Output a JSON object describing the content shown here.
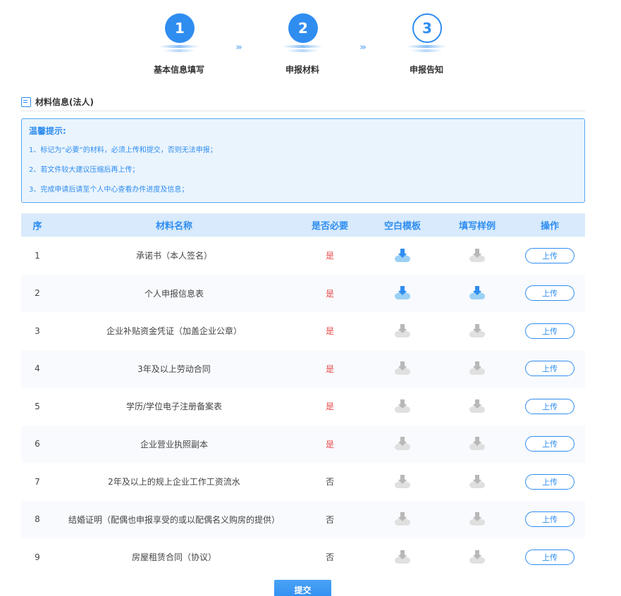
{
  "steps": [
    {
      "number": "1",
      "label": "基本信息填写",
      "state": "active"
    },
    {
      "number": "2",
      "label": "申报材料",
      "state": "active"
    },
    {
      "number": "3",
      "label": "申报告知",
      "state": "inactive"
    }
  ],
  "section": {
    "title": "材料信息(法人)"
  },
  "tips": {
    "title": "温馨提示:",
    "items": [
      "1、标记为“必要”的材料，必须上传和提交，否则无法申报；",
      "2、若文件较大建议压缩后再上传；",
      "3、完成申请后请至个人中心查看办件进度及信息；"
    ]
  },
  "table": {
    "headers": [
      "序",
      "材料名称",
      "是否必要",
      "空白模板",
      "填写样例",
      "操作"
    ],
    "rows": [
      {
        "index": "1",
        "name": "承诺书（本人签名）",
        "required": "是",
        "template": true,
        "example": false,
        "action": "上传"
      },
      {
        "index": "2",
        "name": "个人申报信息表",
        "required": "是",
        "template": true,
        "example": true,
        "action": "上传"
      },
      {
        "index": "3",
        "name": "企业补贴资金凭证（加盖企业公章）",
        "required": "是",
        "template": false,
        "example": false,
        "action": "上传"
      },
      {
        "index": "4",
        "name": "3年及以上劳动合同",
        "required": "是",
        "template": false,
        "example": false,
        "action": "上传"
      },
      {
        "index": "5",
        "name": "学历/学位电子注册备案表",
        "required": "是",
        "template": false,
        "example": false,
        "action": "上传"
      },
      {
        "index": "6",
        "name": "企业营业执照副本",
        "required": "是",
        "template": false,
        "example": false,
        "action": "上传"
      },
      {
        "index": "7",
        "name": "2年及以上的规上企业工作工资流水",
        "required": "否",
        "template": false,
        "example": false,
        "action": "上传"
      },
      {
        "index": "8",
        "name": "结婚证明（配偶也申报享受的或以配偶名义购房的提供）",
        "required": "否",
        "template": false,
        "example": false,
        "action": "上传"
      },
      {
        "index": "9",
        "name": "房屋租赁合同（协议）",
        "required": "否",
        "template": false,
        "example": false,
        "action": "上传"
      }
    ]
  },
  "submit": {
    "label": "提交"
  },
  "colors": {
    "primary": "#2f8df0",
    "required": "#e84a4a",
    "header_bg": "#d8eafc",
    "tips_bg": "#eaf4fd"
  }
}
